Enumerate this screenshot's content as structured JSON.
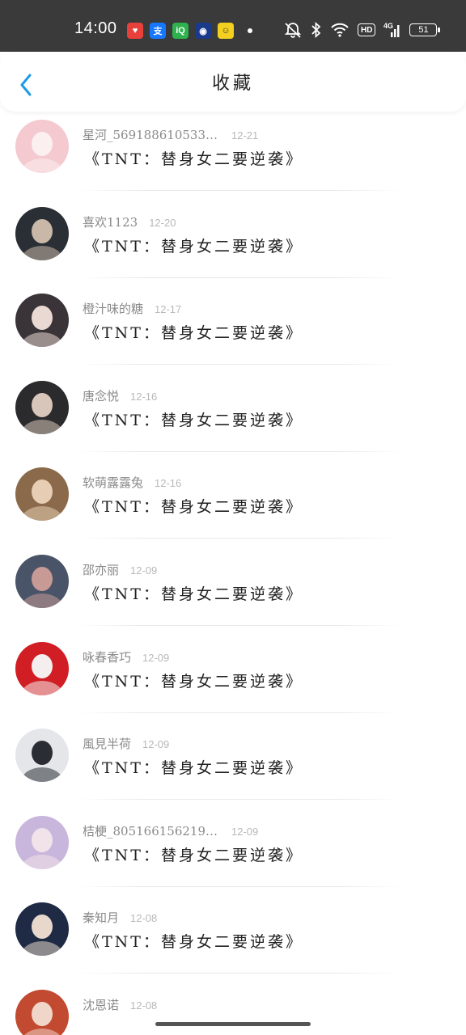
{
  "status_bar": {
    "time": "14:00",
    "battery": "51",
    "hd_label": "HD",
    "network_label": "4G",
    "app_icons": [
      {
        "name": "red-heart-app-icon",
        "color": "#e8413c",
        "glyph": "♥"
      },
      {
        "name": "alipay-icon",
        "color": "#1677ff",
        "glyph": "支"
      },
      {
        "name": "iqiyi-icon",
        "color": "#2db24d",
        "glyph": "iQ"
      },
      {
        "name": "blue-app-icon",
        "color": "#1a3a8a",
        "glyph": "◉"
      },
      {
        "name": "yellow-app-icon",
        "color": "#f3d020",
        "glyph": "☺"
      }
    ]
  },
  "header": {
    "title": "收藏",
    "back_icon": "chevron-left-icon",
    "accent_color": "#1e9be6"
  },
  "items": [
    {
      "username": "星河_5691886105338…",
      "date": "12-21",
      "title": "《TNT：替身女二要逆袭》",
      "avatar_color": "#f4c9cf",
      "avatar_accent": "#fbeff0"
    },
    {
      "username": "喜欢1123",
      "date": "12-20",
      "title": "《TNT：替身女二要逆袭》",
      "avatar_color": "#2a2f35",
      "avatar_accent": "#c9b8a8"
    },
    {
      "username": "橙汁味的糖",
      "date": "12-17",
      "title": "《TNT：替身女二要逆袭》",
      "avatar_color": "#3a3438",
      "avatar_accent": "#e9d9d2"
    },
    {
      "username": "唐念悦",
      "date": "12-16",
      "title": "《TNT：替身女二要逆袭》",
      "avatar_color": "#2b2a2c",
      "avatar_accent": "#d8c6bb"
    },
    {
      "username": "软萌露露兔",
      "date": "12-16",
      "title": "《TNT：替身女二要逆袭》",
      "avatar_color": "#8a6a4a",
      "avatar_accent": "#e6cdb3"
    },
    {
      "username": "邵亦丽",
      "date": "12-09",
      "title": "《TNT：替身女二要逆袭》",
      "avatar_color": "#4a5468",
      "avatar_accent": "#c79a95"
    },
    {
      "username": "咏春香巧",
      "date": "12-09",
      "title": "《TNT：替身女二要逆袭》",
      "avatar_color": "#d01e24",
      "avatar_accent": "#f5eeee"
    },
    {
      "username": "風見半荷",
      "date": "12-09",
      "title": "《TNT：替身女二要逆袭》",
      "avatar_color": "#e4e6ea",
      "avatar_accent": "#2a2d33"
    },
    {
      "username": "桔梗_80516615621915939",
      "date": "12-09",
      "title": "《TNT：替身女二要逆袭》",
      "avatar_color": "#c9b6dc",
      "avatar_accent": "#f2e3ea"
    },
    {
      "username": "秦知月",
      "date": "12-08",
      "title": "《TNT：替身女二要逆袭》",
      "avatar_color": "#1f2a44",
      "avatar_accent": "#e8d8cc"
    },
    {
      "username": "沈恩诺",
      "date": "12-08",
      "title": "",
      "avatar_color": "#c24a30",
      "avatar_accent": "#f0d6c8"
    }
  ]
}
